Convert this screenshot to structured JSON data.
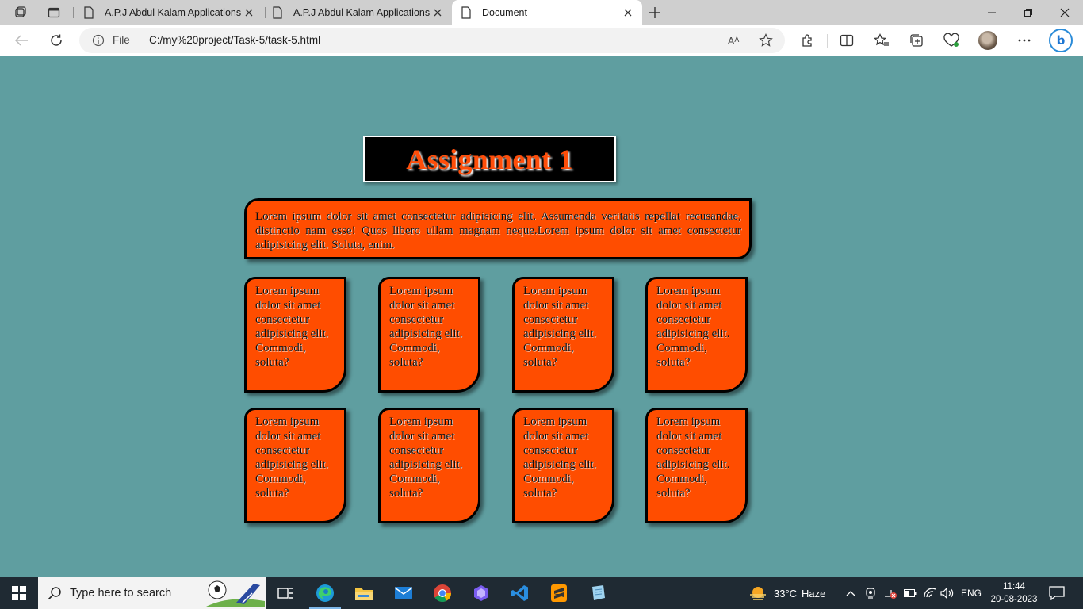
{
  "browser": {
    "tabs": [
      {
        "title": "A.P.J Abdul Kalam Applications"
      },
      {
        "title": "A.P.J Abdul Kalam Applications"
      },
      {
        "title": "Document"
      }
    ],
    "address": {
      "scheme_label": "File",
      "url": "C:/my%20project/Task-5/task-5.html",
      "read_aloud_label": "Aᴬ"
    }
  },
  "page": {
    "title": "Assignment 1",
    "intro": "Lorem ipsum dolor sit amet consectetur adipisicing elit. Assumenda veritatis repellat recusandae, distinctio nam esse! Quos libero ullam magnam neque.Lorem ipsum dolor sit amet consectetur adipisicing elit. Soluta, enim.",
    "cards": [
      {
        "text": "Lorem ipsum dolor sit amet consectetur adipisicing elit. Commodi, soluta?"
      },
      {
        "text": "Lorem ipsum dolor sit amet consectetur adipisicing elit. Commodi, soluta?"
      },
      {
        "text": "Lorem ipsum dolor sit amet consectetur adipisicing elit. Commodi, soluta?"
      },
      {
        "text": "Lorem ipsum dolor sit amet consectetur adipisicing elit. Commodi, soluta?"
      },
      {
        "text": "Lorem ipsum dolor sit amet consectetur adipisicing elit. Commodi, soluta?"
      },
      {
        "text": "Lorem ipsum dolor sit amet consectetur adipisicing elit. Commodi, soluta?"
      },
      {
        "text": "Lorem ipsum dolor sit amet consectetur adipisicing elit. Commodi, soluta?"
      },
      {
        "text": "Lorem ipsum dolor sit amet consectetur adipisicing elit. Commodi, soluta?"
      }
    ],
    "colors": {
      "background": "#5f9ea0",
      "accent": "#ff4d00",
      "title_bg": "#000000"
    }
  },
  "taskbar": {
    "search_placeholder": "Type here to search",
    "apps": [
      "task-view-icon",
      "edge-icon",
      "file-explorer-icon",
      "mail-icon",
      "chrome-icon",
      "copilot-icon",
      "vscode-icon",
      "sublime-text-icon",
      "notepad-icon"
    ],
    "weather": {
      "temp": "33°C",
      "condition": "Haze"
    },
    "language": "ENG",
    "time": "11:44",
    "date": "20-08-2023"
  }
}
